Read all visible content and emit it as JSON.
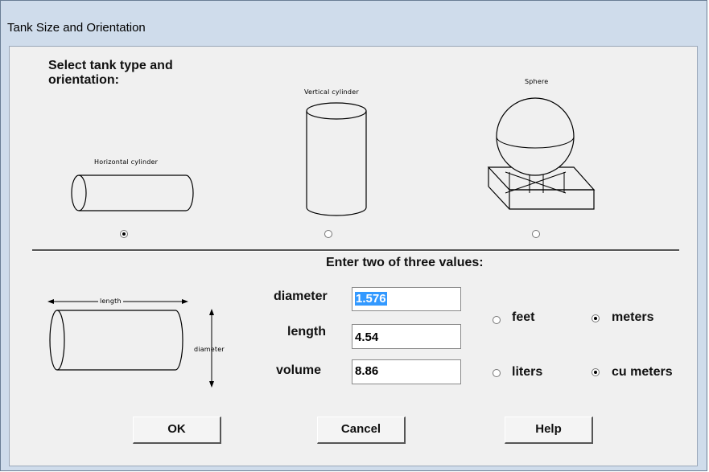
{
  "window": {
    "title": "Tank Size and Orientation"
  },
  "tank_type": {
    "heading_line1": "Select tank type and",
    "heading_line2": "orientation:",
    "options": [
      {
        "label": "Horizontal cylinder",
        "selected": true
      },
      {
        "label": "Vertical cylinder",
        "selected": false
      },
      {
        "label": "Sphere",
        "selected": false
      }
    ]
  },
  "values": {
    "heading": "Enter two of three values:",
    "diagram_length_label": "length",
    "diagram_diameter_label": "diameter",
    "diameter_label": "diameter",
    "diameter_value": "1.576",
    "length_label": "length",
    "length_value": "4.54",
    "volume_label": "volume",
    "volume_value": "8.86"
  },
  "units": {
    "length_options": [
      {
        "label": "feet",
        "selected": false
      },
      {
        "label": "meters",
        "selected": true
      }
    ],
    "volume_options": [
      {
        "label": "liters",
        "selected": false
      },
      {
        "label": "cu meters",
        "selected": true
      }
    ]
  },
  "buttons": {
    "ok": "OK",
    "cancel": "Cancel",
    "help": "Help"
  }
}
